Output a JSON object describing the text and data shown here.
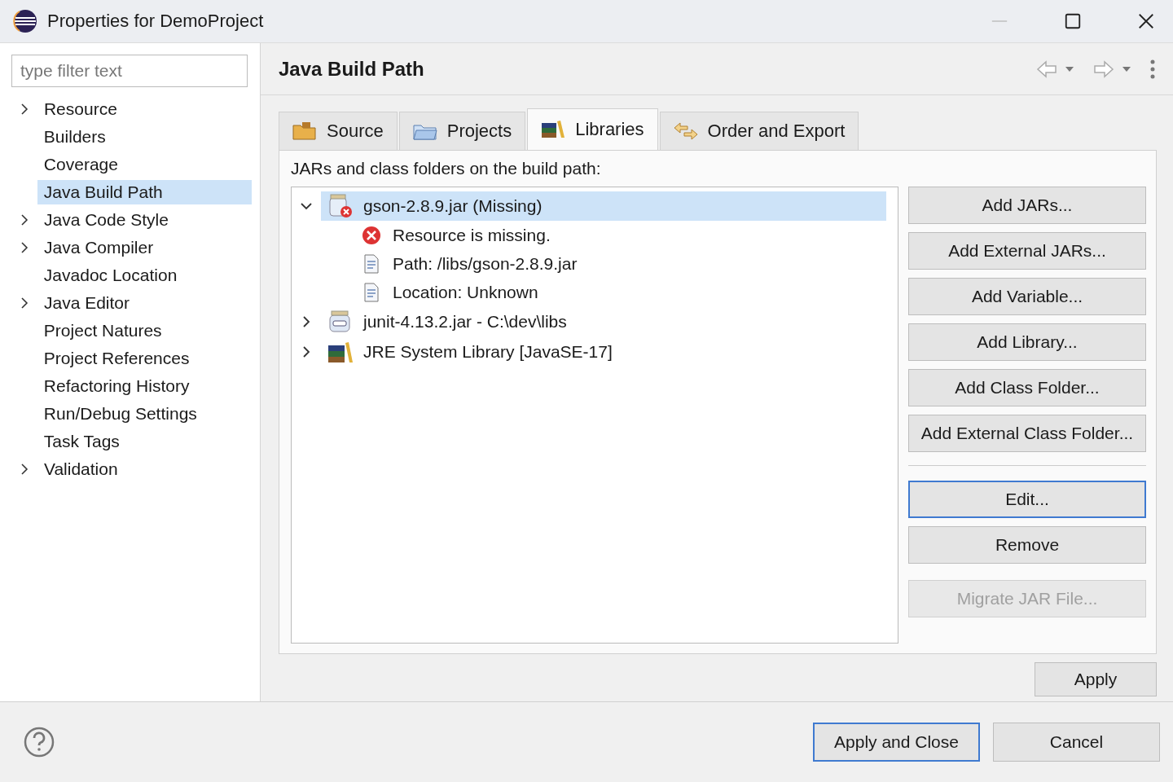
{
  "window": {
    "title": "Properties for DemoProject"
  },
  "filter": {
    "placeholder": "type filter text"
  },
  "sidebar": {
    "items": [
      {
        "label": "Resource",
        "kind": "folder",
        "selected": false
      },
      {
        "label": "Builders",
        "kind": "page",
        "selected": false
      },
      {
        "label": "Coverage",
        "kind": "page",
        "selected": false
      },
      {
        "label": "Java Build Path",
        "kind": "page",
        "selected": true
      },
      {
        "label": "Java Code Style",
        "kind": "folder",
        "selected": false
      },
      {
        "label": "Java Compiler",
        "kind": "folder",
        "selected": false
      },
      {
        "label": "Javadoc Location",
        "kind": "page",
        "selected": false
      },
      {
        "label": "Java Editor",
        "kind": "folder",
        "selected": false
      },
      {
        "label": "Project Natures",
        "kind": "page",
        "selected": false
      },
      {
        "label": "Project References",
        "kind": "page",
        "selected": false
      },
      {
        "label": "Refactoring History",
        "kind": "page",
        "selected": false
      },
      {
        "label": "Run/Debug Settings",
        "kind": "page",
        "selected": false
      },
      {
        "label": "Task Tags",
        "kind": "page",
        "selected": false
      },
      {
        "label": "Validation",
        "kind": "folder",
        "selected": false
      }
    ]
  },
  "page": {
    "title": "Java Build Path"
  },
  "tabs": [
    {
      "label": "Source",
      "kind": "source",
      "selected": false
    },
    {
      "label": "Projects",
      "kind": "projects",
      "selected": false
    },
    {
      "label": "Libraries",
      "kind": "libraries",
      "selected": true
    },
    {
      "label": "Order and Export",
      "kind": "order",
      "selected": false
    }
  ],
  "libraries": {
    "caption": "JARs and class folders on the build path:",
    "items": [
      {
        "label": "gson-2.8.9.jar (Missing)",
        "kind": "missing-jar",
        "expanded": true,
        "selected": true,
        "children": [
          {
            "label": "Resource is missing.",
            "kind": "error"
          },
          {
            "label": "Path: /libs/gson-2.8.9.jar",
            "kind": "info"
          },
          {
            "label": "Location: Unknown",
            "kind": "info"
          }
        ]
      },
      {
        "label": "junit-4.13.2.jar - C:\\dev\\libs",
        "kind": "jar",
        "expanded": false,
        "selected": false
      },
      {
        "label": "JRE System Library [JavaSE-17]",
        "kind": "jre",
        "expanded": false,
        "selected": false
      }
    ]
  },
  "button_groups": [
    [
      {
        "label": "Add JARs...",
        "disabled": false,
        "focused": false
      },
      {
        "label": "Add External JARs...",
        "disabled": false,
        "focused": false
      },
      {
        "label": "Add Variable...",
        "disabled": false,
        "focused": false
      },
      {
        "label": "Add Library...",
        "disabled": false,
        "focused": false
      },
      {
        "label": "Add Class Folder...",
        "disabled": false,
        "focused": false
      },
      {
        "label": "Add External Class Folder...",
        "disabled": false,
        "focused": false
      }
    ],
    [
      {
        "label": "Edit...",
        "disabled": false,
        "focused": true
      },
      {
        "label": "Remove",
        "disabled": false,
        "focused": false
      }
    ],
    [
      {
        "label": "Migrate JAR File...",
        "disabled": true,
        "focused": false
      }
    ]
  ],
  "apply": "Apply",
  "footer": {
    "buttons": [
      {
        "label": "Apply and Close",
        "focused": true
      },
      {
        "label": "Cancel",
        "focused": false
      }
    ]
  }
}
